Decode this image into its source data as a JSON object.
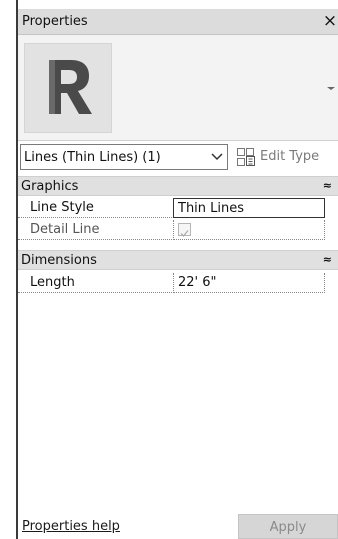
{
  "panel": {
    "title": "Properties",
    "close_glyph": "×",
    "close_icon": "close-icon"
  },
  "type_preview": {
    "icon": "revit-r-logo",
    "dropdown_icon": "dropdown-arrow-icon"
  },
  "selector": {
    "value": "Lines (Thin Lines) (1)",
    "chevron_icon": "chevron-down-icon"
  },
  "edit_type": {
    "label": "Edit Type",
    "icon": "edit-type-icon"
  },
  "groups": [
    {
      "label": "Graphics",
      "collapse_glyph": "≈",
      "rows": [
        {
          "name": "Line Style",
          "value": "Thin Lines"
        },
        {
          "name": "Detail Line",
          "checked": true
        }
      ]
    },
    {
      "label": "Dimensions",
      "collapse_glyph": "≈",
      "rows": [
        {
          "name": "Length",
          "value": "22'  6\""
        }
      ]
    }
  ],
  "footer": {
    "help_link": "Properties help",
    "apply_label": "Apply"
  }
}
